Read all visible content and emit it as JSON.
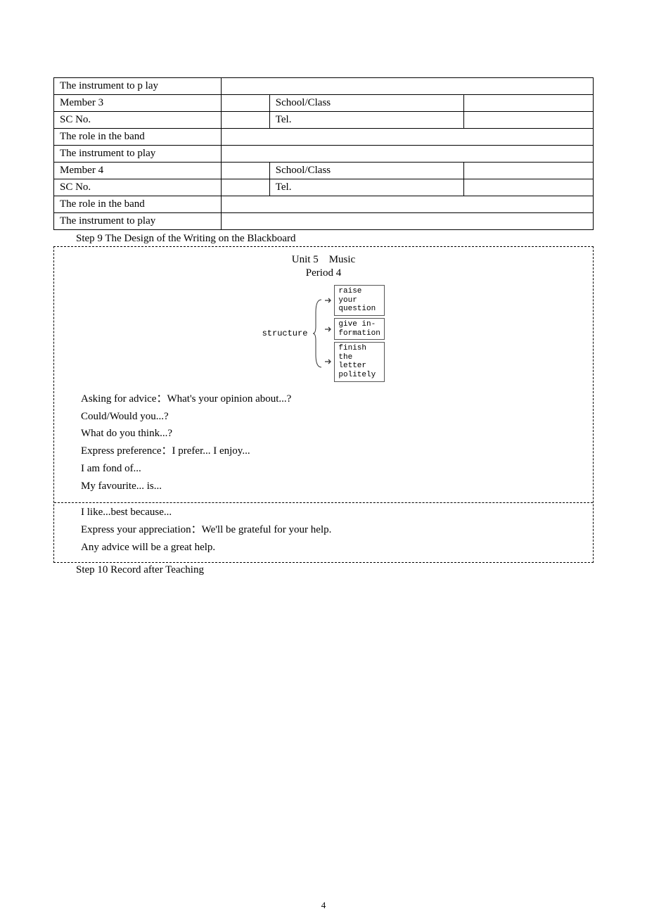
{
  "table": {
    "rows": [
      [
        "The instrument to p lay",
        "",
        "",
        ""
      ],
      [
        "Member 3",
        "",
        "School/Class",
        ""
      ],
      [
        "SC No.",
        "",
        "Tel.",
        ""
      ],
      [
        "The role in the band",
        "",
        "",
        ""
      ],
      [
        "The instrument to play",
        "",
        "",
        ""
      ],
      [
        "Member 4",
        "",
        "School/Class",
        ""
      ],
      [
        "SC No.",
        "",
        "Tel.",
        ""
      ],
      [
        "The role in the band",
        "",
        "",
        ""
      ],
      [
        "The instrument to play",
        "",
        "",
        ""
      ]
    ]
  },
  "step9": "Step 9 The Design of the Writing on the Blackboard",
  "blackboard": {
    "title": "Unit 5　Music",
    "subtitle": "Period 4",
    "structureLabel": "structure",
    "items": {
      "i1": "raise your question",
      "i2": "give in-formation",
      "i3": "finish the letter politely"
    },
    "lines1": {
      "l1": "Asking for advice：What's your opinion about...?",
      "l2": "Could/Would you...?",
      "l3": "What do you think...?",
      "l4": "Express preference：I prefer... I enjoy...",
      "l5": "I am fond of...",
      "l6": "My favourite... is..."
    },
    "lines2": {
      "l1": "I like...best because...",
      "l2": "Express your appreciation：We'll be grateful for your help.",
      "l3": "Any advice will be a great help."
    }
  },
  "step10": "Step 10 Record after Teaching",
  "pageNumber": "4"
}
